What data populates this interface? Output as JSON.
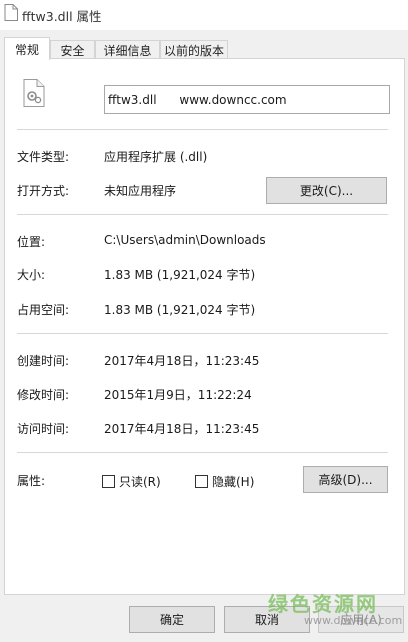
{
  "window": {
    "title": "fftw3.dll 属性"
  },
  "tabs": [
    {
      "label": "常规",
      "active": true
    },
    {
      "label": "安全",
      "active": false
    },
    {
      "label": "详细信息",
      "active": false
    },
    {
      "label": "以前的版本",
      "active": false
    }
  ],
  "file": {
    "name": "fftw3.dll      www.downcc.com"
  },
  "info": {
    "type_label": "文件类型:",
    "type_value": "应用程序扩展 (.dll)",
    "open_label": "打开方式:",
    "open_value": "未知应用程序",
    "change_button": "更改(C)...",
    "location_label": "位置:",
    "location_value": "C:\\Users\\admin\\Downloads",
    "size_label": "大小:",
    "size_value": "1.83 MB (1,921,024 字节)",
    "disk_label": "占用空间:",
    "disk_value": "1.83 MB (1,921,024 字节)",
    "created_label": "创建时间:",
    "created_value": "2017年4月18日，11:23:45",
    "modified_label": "修改时间:",
    "modified_value": "2015年1月9日，11:22:24",
    "accessed_label": "访问时间:",
    "accessed_value": "2017年4月18日，11:23:45"
  },
  "attributes": {
    "label": "属性:",
    "readonly": {
      "label": "只读(R)",
      "checked": false
    },
    "hidden": {
      "label": "隐藏(H)",
      "checked": false
    },
    "advanced_button": "高级(D)..."
  },
  "buttons": {
    "ok": "确定",
    "cancel": "取消",
    "apply": "应用(A)"
  },
  "watermark": {
    "big": "绿色资源网",
    "small": "www.downcc.com"
  }
}
